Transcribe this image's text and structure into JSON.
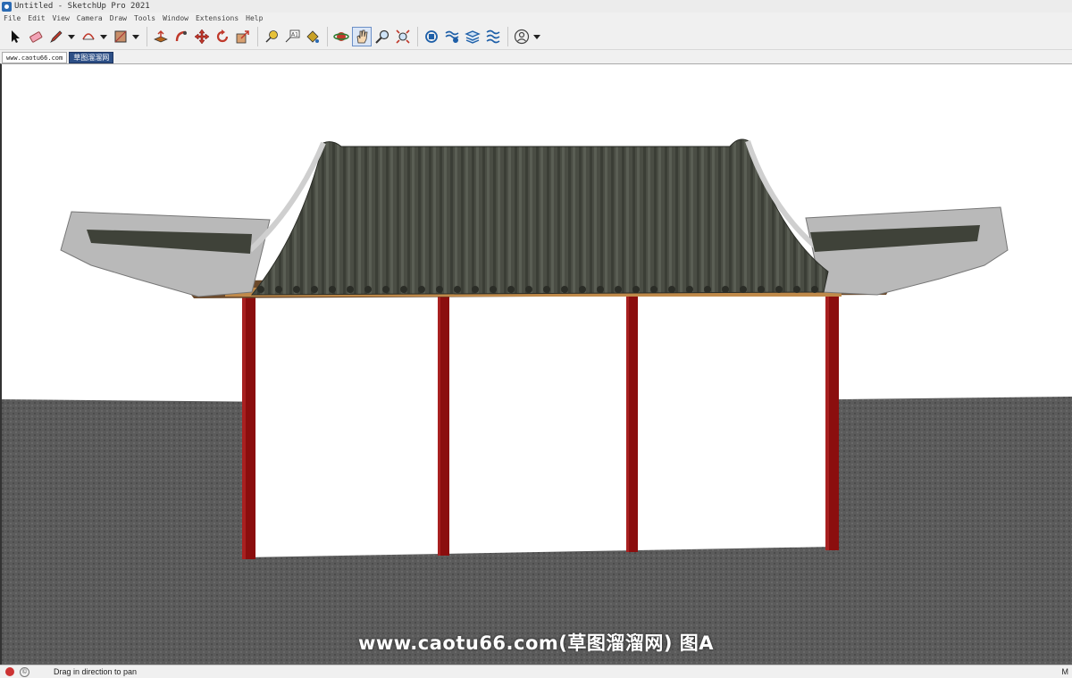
{
  "window": {
    "title": "Untitled - SketchUp Pro 2021"
  },
  "menu": [
    "File",
    "Edit",
    "View",
    "Camera",
    "Draw",
    "Tools",
    "Window",
    "Extensions",
    "Help"
  ],
  "toolbar": {
    "tools": [
      {
        "name": "select-tool-icon"
      },
      {
        "name": "eraser-tool-icon"
      },
      {
        "name": "pencil-tool-icon",
        "dropdown": true
      },
      {
        "name": "arc-tool-icon",
        "dropdown": true
      },
      {
        "name": "rectangle-tool-icon",
        "dropdown": true
      },
      {
        "name": "push-pull-tool-icon"
      },
      {
        "name": "follow-me-tool-icon"
      },
      {
        "name": "move-tool-icon"
      },
      {
        "name": "rotate-tool-icon"
      },
      {
        "name": "scale-tool-icon"
      },
      {
        "name": "tape-measure-tool-icon"
      },
      {
        "name": "text-tool-icon"
      },
      {
        "name": "paint-bucket-tool-icon"
      },
      {
        "name": "orbit-tool-icon"
      },
      {
        "name": "pan-tool-icon",
        "active": true
      },
      {
        "name": "zoom-tool-icon"
      },
      {
        "name": "zoom-extents-tool-icon"
      },
      {
        "name": "warehouse-icon"
      },
      {
        "name": "extension-warehouse-icon"
      },
      {
        "name": "layout-icon"
      },
      {
        "name": "extension-manager-icon"
      },
      {
        "name": "account-icon",
        "dropdown": true
      }
    ]
  },
  "tabs": [
    {
      "label": "www.caotu66.com"
    },
    {
      "label": "草图溜溜网"
    }
  ],
  "viewport": {
    "watermark": "www.caotu66.com(草图溜溜网) 图A",
    "colors": {
      "sky": "#ffffff",
      "ground": "#585858",
      "roof": "#3f4239",
      "column": "#8b0e0e",
      "rafter": "#c08a4a"
    }
  },
  "status": {
    "hint": "Drag in direction to pan",
    "measurements_label": "M"
  }
}
